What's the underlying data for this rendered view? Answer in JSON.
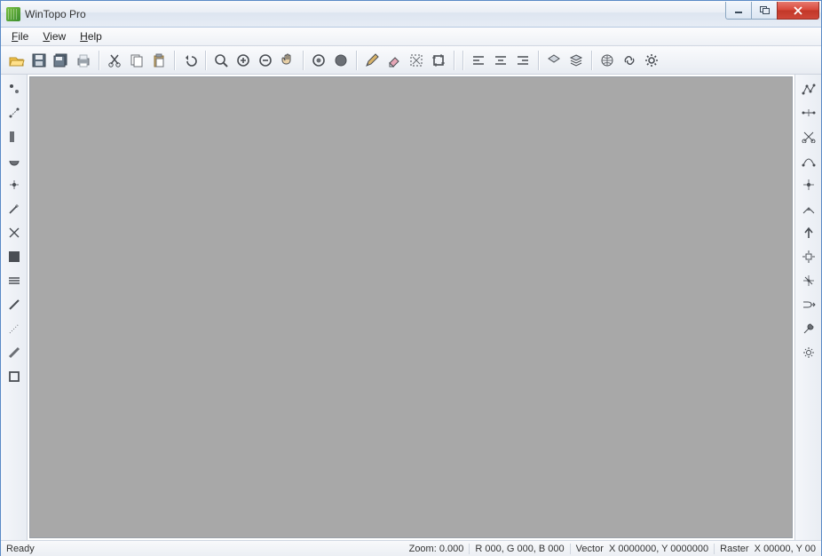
{
  "window": {
    "title": "WinTopo Pro"
  },
  "menu": {
    "file": "File",
    "view": "View",
    "help": "Help"
  },
  "toolbar": [
    {
      "name": "open-icon"
    },
    {
      "name": "save-icon"
    },
    {
      "name": "save-all-icon"
    },
    {
      "name": "print-icon"
    },
    "sep",
    {
      "name": "cut-icon"
    },
    {
      "name": "copy-icon"
    },
    {
      "name": "paste-icon"
    },
    "sep",
    {
      "name": "undo-icon"
    },
    "sep",
    {
      "name": "zoom-icon"
    },
    {
      "name": "zoom-in-icon"
    },
    {
      "name": "zoom-out-icon"
    },
    {
      "name": "pan-icon"
    },
    "sep",
    {
      "name": "region-icon"
    },
    {
      "name": "region-fill-icon"
    },
    "sep",
    {
      "name": "pencil-icon"
    },
    {
      "name": "eraser-icon"
    },
    {
      "name": "select-area-icon"
    },
    {
      "name": "crop-icon"
    },
    "sep",
    "sep",
    {
      "name": "align-left-icon"
    },
    {
      "name": "align-center-icon"
    },
    {
      "name": "align-right-icon"
    },
    "sep",
    {
      "name": "layer-icon"
    },
    {
      "name": "layer-stack-icon"
    },
    "sep",
    {
      "name": "globe-icon"
    },
    {
      "name": "link-icon"
    },
    {
      "name": "gear-icon"
    }
  ],
  "left_tools": [
    {
      "name": "point-tool-icon"
    },
    {
      "name": "snap-tool-icon"
    },
    {
      "name": "box-tool-icon"
    },
    {
      "name": "arc-tool-icon"
    },
    {
      "name": "direction-tool-icon"
    },
    {
      "name": "wand-tool-icon"
    },
    {
      "name": "cross-tool-icon"
    },
    {
      "name": "fill-square-icon"
    },
    {
      "name": "lines-icon"
    },
    {
      "name": "brush1-icon"
    },
    {
      "name": "dots-icon"
    },
    {
      "name": "brush2-icon"
    },
    {
      "name": "rect-outline-icon"
    }
  ],
  "right_tools": [
    {
      "name": "polyline-icon"
    },
    {
      "name": "edit-line-icon"
    },
    {
      "name": "scissors-icon"
    },
    {
      "name": "curve-icon"
    },
    {
      "name": "snap-node-icon"
    },
    {
      "name": "join-icon"
    },
    {
      "name": "arrow-up-icon"
    },
    {
      "name": "target-icon"
    },
    {
      "name": "anchor-icon"
    },
    {
      "name": "merge-icon"
    },
    {
      "name": "wrench-icon"
    },
    {
      "name": "settings-small-icon"
    }
  ],
  "status": {
    "ready": "Ready",
    "zoom_label": "Zoom:",
    "zoom_value": "0.000",
    "rgb": "R 000, G 000, B 000",
    "vector_label": "Vector",
    "vector_value": "X 0000000, Y 0000000",
    "raster_label": "Raster",
    "raster_value": "X 00000, Y 00"
  },
  "colors": {
    "canvas": "#a8a8a8"
  }
}
